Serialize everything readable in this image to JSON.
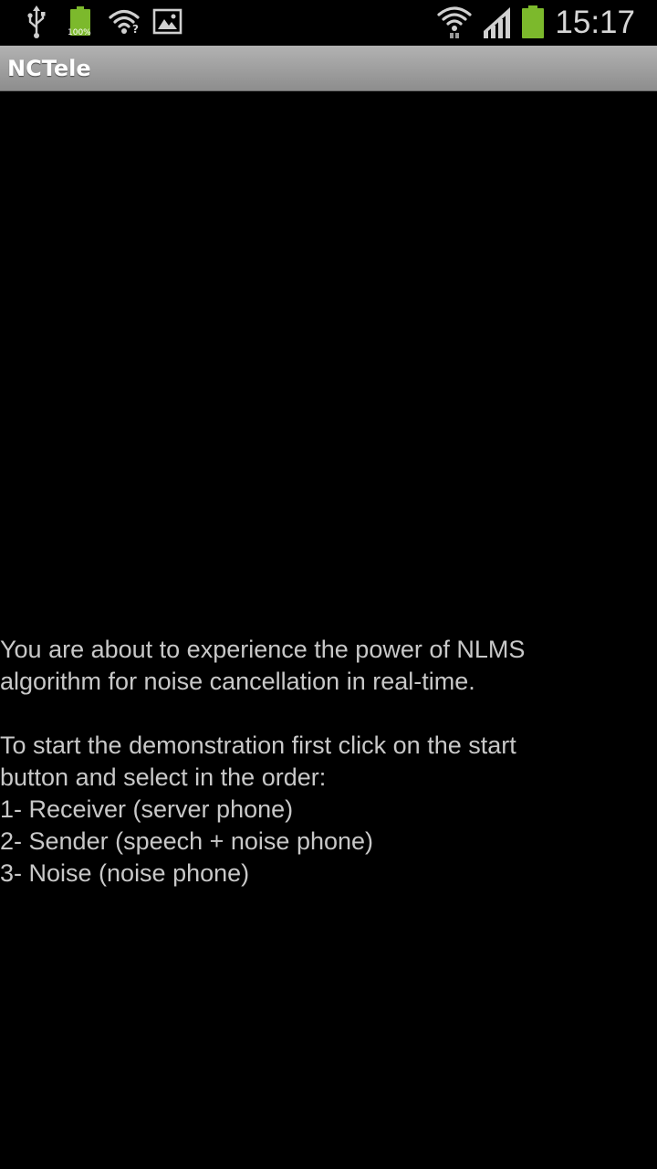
{
  "status_bar": {
    "time": "15:17",
    "battery_percent": "100%",
    "icons": [
      "usb-icon",
      "battery-charging-icon",
      "wifi-notification-icon",
      "gallery-icon",
      "wifi-signal-icon",
      "cell-signal-icon",
      "battery-icon"
    ],
    "accent_green": "#7cb92c"
  },
  "app_bar": {
    "title": "NCTele"
  },
  "main": {
    "intro_lines": [
      "You are about to experience the power of NLMS",
      "algorithm for noise cancellation in real-time."
    ],
    "instruction_lines": [
      "To start the demonstration first click on the start",
      "button and select in the order:"
    ],
    "steps": [
      "1- Receiver (server phone)",
      "2- Sender (speech + noise phone)",
      "3- Noise (noise phone)"
    ]
  }
}
